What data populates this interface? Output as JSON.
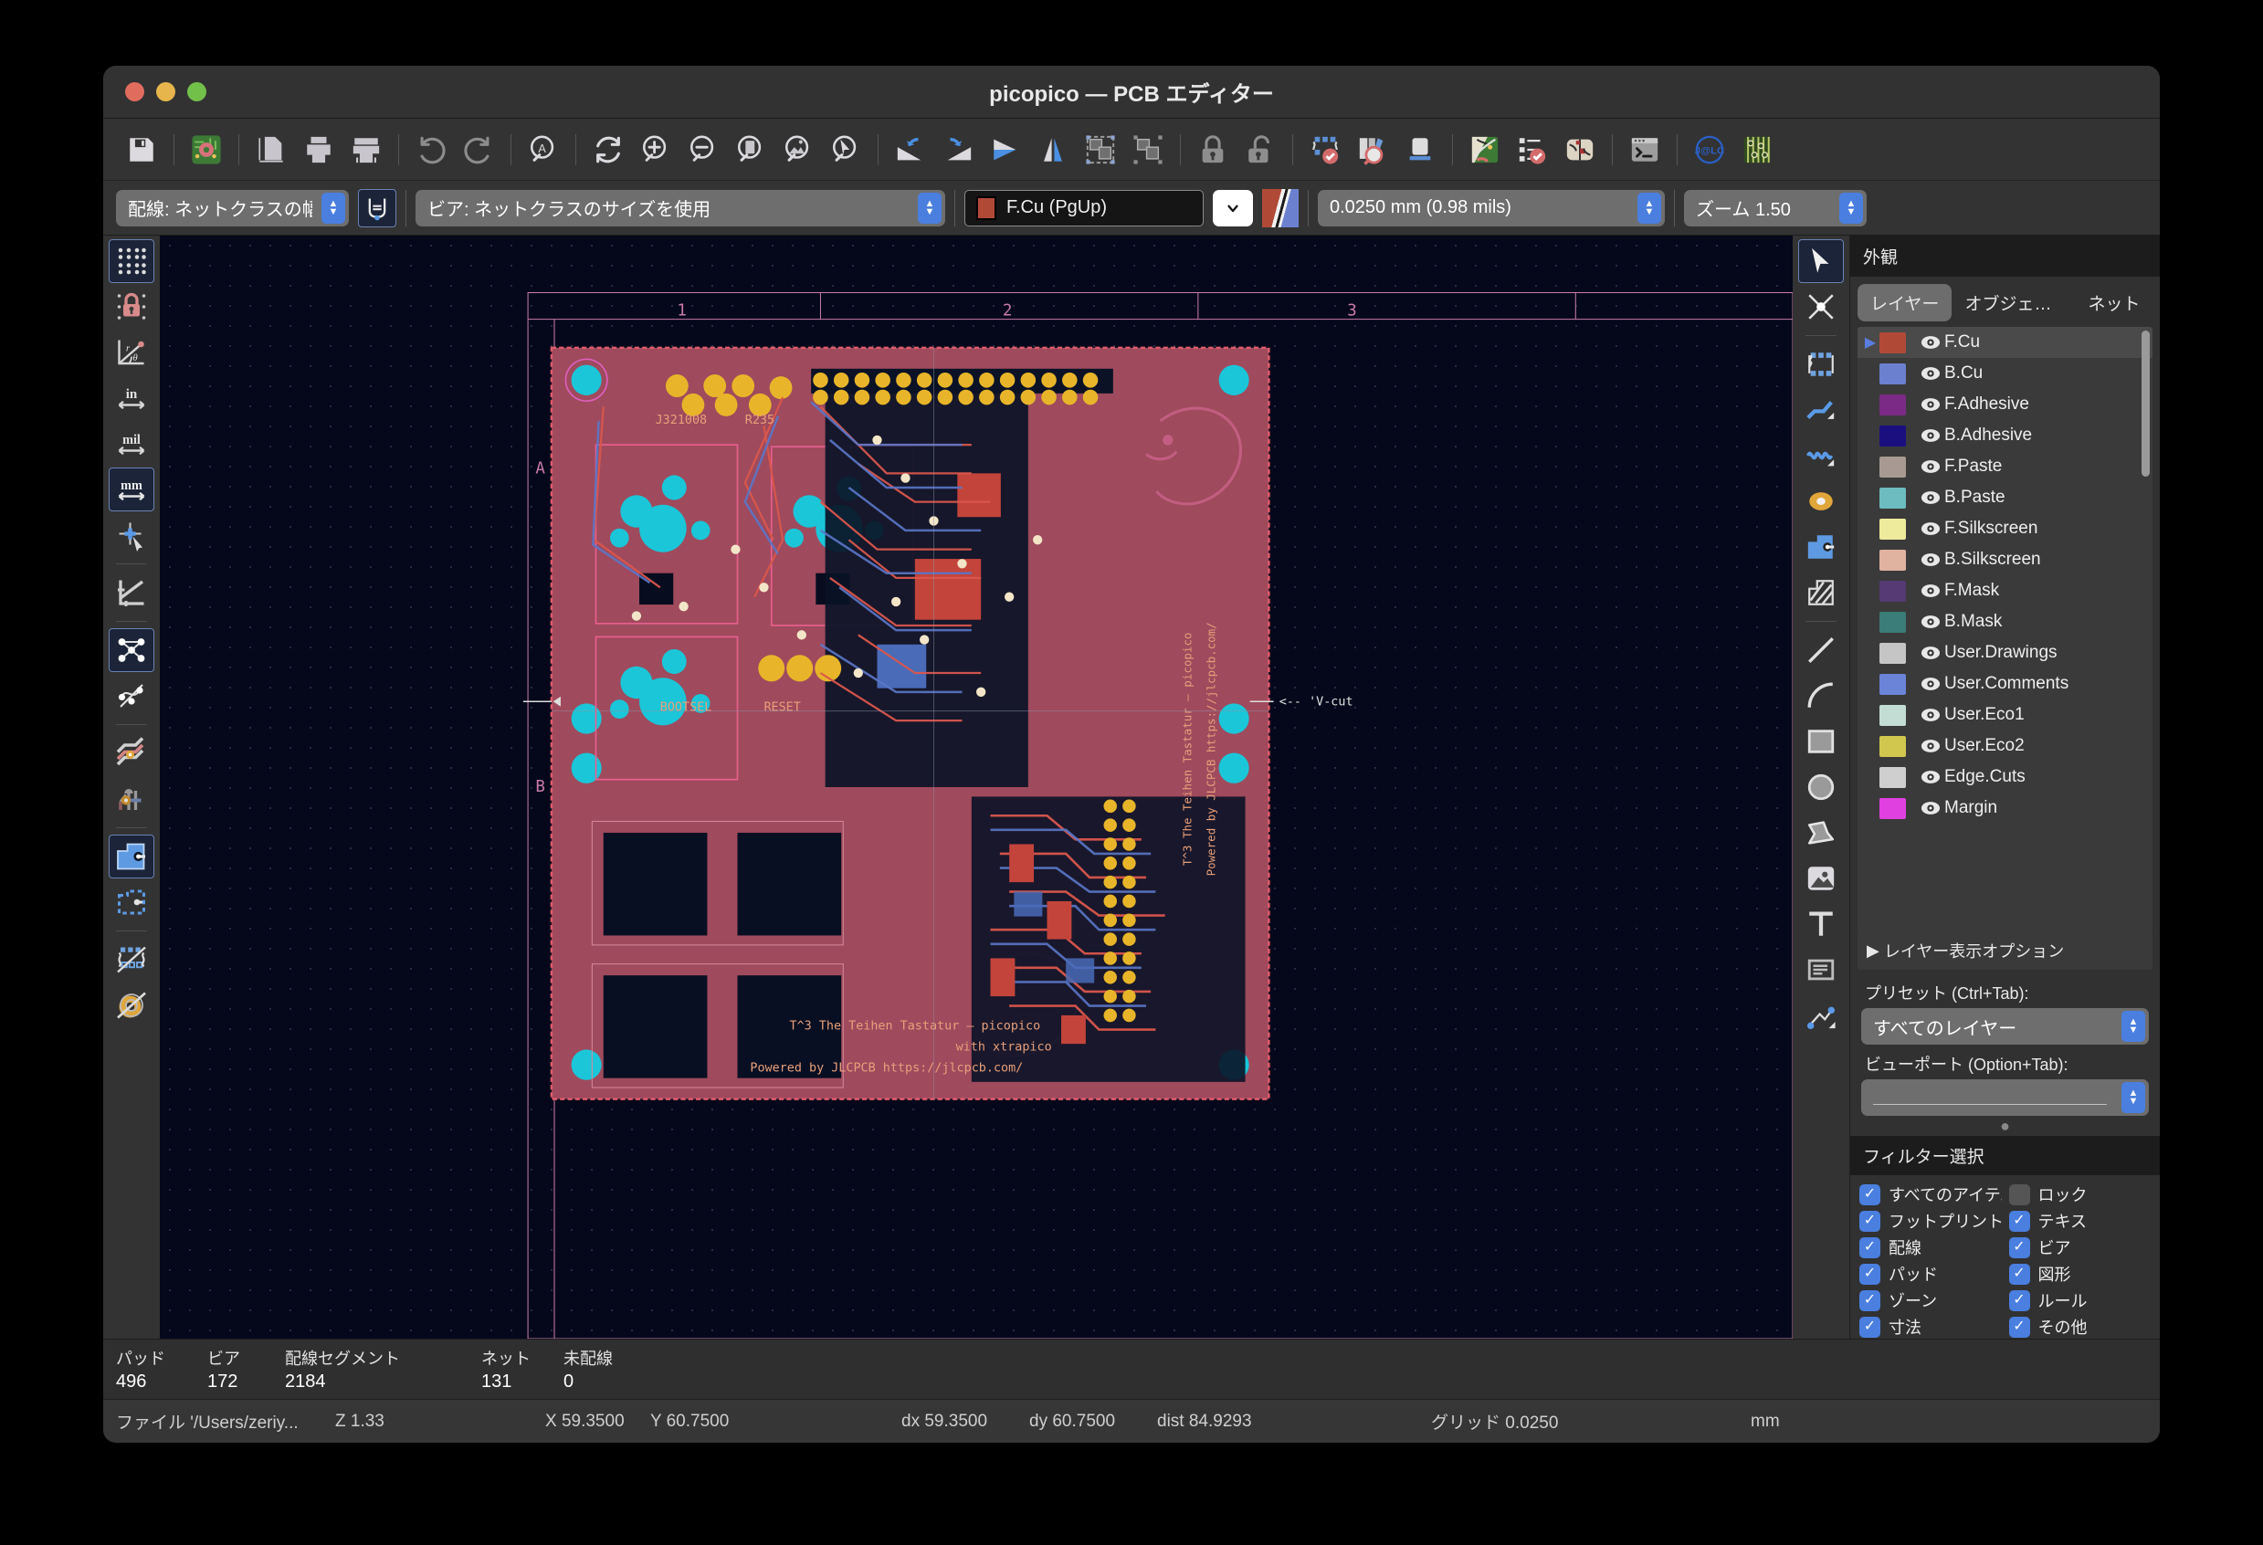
{
  "window": {
    "title": "picopico — PCB エディター",
    "traffic_lights": [
      "close",
      "minimize",
      "zoom"
    ]
  },
  "main_toolbar": [
    {
      "name": "save-button",
      "icon": "floppy-disk-icon"
    },
    {
      "name": "board-setup-button",
      "icon": "board-setup-icon"
    },
    {
      "name": "page-settings-button",
      "icon": "page-settings-icon"
    },
    {
      "name": "print-button",
      "icon": "printer-icon"
    },
    {
      "name": "plot-button",
      "icon": "plotter-icon"
    },
    {
      "name": "undo-button",
      "icon": "undo-arrow-icon"
    },
    {
      "name": "redo-button",
      "icon": "redo-arrow-icon"
    },
    {
      "name": "find-button",
      "icon": "find-text-icon"
    },
    {
      "name": "refresh-button",
      "icon": "refresh-icon"
    },
    {
      "name": "zoom-in-button",
      "icon": "zoom-in-icon"
    },
    {
      "name": "zoom-out-button",
      "icon": "zoom-out-icon"
    },
    {
      "name": "zoom-fit-page-button",
      "icon": "zoom-fit-page-icon"
    },
    {
      "name": "zoom-fit-objects-button",
      "icon": "zoom-fit-objects-icon"
    },
    {
      "name": "zoom-select-button",
      "icon": "zoom-selection-icon"
    },
    {
      "name": "rotate-ccw-button",
      "icon": "rotate-ccw-icon"
    },
    {
      "name": "rotate-cw-button",
      "icon": "rotate-cw-icon"
    },
    {
      "name": "flip-horizontal-button",
      "icon": "flip-horizontal-icon"
    },
    {
      "name": "mirror-button",
      "icon": "mirror-icon"
    },
    {
      "name": "group-button",
      "icon": "group-icon"
    },
    {
      "name": "ungroup-button",
      "icon": "ungroup-icon"
    },
    {
      "name": "lock-button",
      "icon": "lock-closed-icon"
    },
    {
      "name": "unlock-button",
      "icon": "lock-open-icon"
    },
    {
      "name": "footprint-editor-button",
      "icon": "footprint-editor-icon"
    },
    {
      "name": "footprint-browser-button",
      "icon": "footprint-browser-icon"
    },
    {
      "name": "viewer-3d-button",
      "icon": "three-d-viewer-icon"
    },
    {
      "name": "update-pcb-button",
      "icon": "update-pcb-from-schematic-icon"
    },
    {
      "name": "drc-button",
      "icon": "design-rules-check-icon"
    },
    {
      "name": "netlist-button",
      "icon": "net-inspector-icon"
    },
    {
      "name": "scripting-console-button",
      "icon": "python-console-icon"
    },
    {
      "name": "jlc-tools-button",
      "icon": "jlc-logo-icon"
    },
    {
      "name": "fabrication-toolkit-button",
      "icon": "fabrication-toolkit-icon"
    }
  ],
  "secondary_toolbar": {
    "track_width": {
      "label": "配線: ネットクラスの幅を使用",
      "name": "track-width-select"
    },
    "track_width_auto": {
      "name": "auto-track-width-toggle",
      "icon": "auto-track-width-icon",
      "active": true
    },
    "via_size": {
      "label": "ビア: ネットクラスのサイズを使用",
      "name": "via-size-select"
    },
    "active_layer": {
      "label": "F.Cu (PgUp)",
      "color": "#b04a37",
      "name": "active-layer-select"
    },
    "layer_dropdown": {
      "name": "layer-dropdown-button",
      "icon": "chevron-down-icon"
    },
    "layer_pair": {
      "name": "layer-pair-swatch",
      "front": "#b04a37",
      "back": "#6b81cf"
    },
    "grid_size": {
      "label": "0.0250 mm (0.98 mils)",
      "name": "grid-size-select"
    },
    "zoom_level": {
      "label": "ズーム 1.50",
      "name": "zoom-level-select"
    }
  },
  "left_toolbar": [
    {
      "name": "toggle-grid-button",
      "icon": "grid-dots-icon",
      "active": true
    },
    {
      "name": "grid-lock-button",
      "icon": "grid-lock-icon",
      "active": false
    },
    {
      "name": "polar-coords-button",
      "icon": "polar-coordinates-icon",
      "active": false
    },
    {
      "name": "units-inches-button",
      "icon": "unit-inch-icon",
      "active": false
    },
    {
      "name": "units-mils-button",
      "icon": "unit-mil-icon",
      "active": false
    },
    {
      "name": "units-mm-button",
      "icon": "unit-mm-icon",
      "active": true
    },
    {
      "name": "full-crosshair-button",
      "icon": "crosshair-cursor-icon",
      "active": false
    },
    {
      "name": "show-ratsnest-45-button",
      "icon": "angle-measure-icon",
      "active": false
    },
    {
      "name": "show-ratsnest-button",
      "icon": "ratsnest-icon",
      "active": true
    },
    {
      "name": "ratsnest-curved-button",
      "icon": "ratsnest-curved-icon",
      "active": false
    },
    {
      "name": "track-fill-button",
      "icon": "track-filled-icon",
      "active": false
    },
    {
      "name": "via-fill-button",
      "icon": "via-filled-icon",
      "active": false
    },
    {
      "name": "zone-filled-button",
      "icon": "zone-filled-icon",
      "active": true
    },
    {
      "name": "zone-outline-button",
      "icon": "zone-outline-icon",
      "active": false
    },
    {
      "name": "footprint-sketch-button",
      "icon": "footprint-sketch-icon",
      "active": false
    },
    {
      "name": "pad-sketch-button",
      "icon": "pad-sketch-icon",
      "active": false
    }
  ],
  "right_toolbar": [
    {
      "name": "select-tool-button",
      "icon": "cursor-arrow-icon",
      "active": true
    },
    {
      "name": "highlight-net-tool-button",
      "icon": "highlight-net-icon",
      "active": false
    },
    {
      "name": "place-footprint-tool-button",
      "icon": "place-footprint-icon",
      "active": false
    },
    {
      "name": "route-track-tool-button",
      "icon": "route-track-icon",
      "active": false
    },
    {
      "name": "route-diff-pair-tool-button",
      "icon": "route-differential-pair-icon",
      "active": false
    },
    {
      "name": "add-via-tool-button",
      "icon": "add-via-icon",
      "active": false
    },
    {
      "name": "add-zone-tool-button",
      "icon": "add-filled-zone-icon",
      "active": false
    },
    {
      "name": "add-rule-area-tool-button",
      "icon": "add-rule-area-icon",
      "active": false
    },
    {
      "name": "draw-line-tool-button",
      "icon": "draw-line-icon",
      "active": false
    },
    {
      "name": "draw-arc-tool-button",
      "icon": "draw-arc-icon",
      "active": false
    },
    {
      "name": "draw-rectangle-tool-button",
      "icon": "draw-rectangle-icon",
      "active": false
    },
    {
      "name": "draw-circle-tool-button",
      "icon": "draw-circle-icon",
      "active": false
    },
    {
      "name": "draw-polygon-tool-button",
      "icon": "draw-polygon-icon",
      "active": false
    },
    {
      "name": "place-image-tool-button",
      "icon": "place-image-icon",
      "active": false
    },
    {
      "name": "add-text-tool-button",
      "icon": "add-text-icon",
      "active": false
    },
    {
      "name": "add-textbox-tool-button",
      "icon": "add-textbox-icon",
      "active": false
    },
    {
      "name": "add-dimension-tool-button",
      "icon": "add-dimension-icon",
      "active": false
    }
  ],
  "appearance": {
    "title": "外観",
    "tabs": [
      {
        "label": "レイヤー",
        "name": "tab-layers",
        "active": true
      },
      {
        "label": "オブジェ…",
        "name": "tab-objects",
        "active": false
      },
      {
        "label": "ネット",
        "name": "tab-nets",
        "active": false
      }
    ],
    "layers": [
      {
        "name": "F.Cu",
        "color": "#b04a37",
        "visible": true,
        "selected": true
      },
      {
        "name": "B.Cu",
        "color": "#6b81cf",
        "visible": true,
        "selected": false
      },
      {
        "name": "F.Adhesive",
        "color": "#7b2b86",
        "visible": true,
        "selected": false
      },
      {
        "name": "B.Adhesive",
        "color": "#1b0f80",
        "visible": true,
        "selected": false
      },
      {
        "name": "F.Paste",
        "color": "#a89a92",
        "visible": true,
        "selected": false
      },
      {
        "name": "B.Paste",
        "color": "#6dbcbf",
        "visible": true,
        "selected": false
      },
      {
        "name": "F.Silkscreen",
        "color": "#eeeb9c",
        "visible": true,
        "selected": false
      },
      {
        "name": "B.Silkscreen",
        "color": "#e0b2a0",
        "visible": true,
        "selected": false
      },
      {
        "name": "F.Mask",
        "color": "#553a74",
        "visible": true,
        "selected": false
      },
      {
        "name": "B.Mask",
        "color": "#3b7d78",
        "visible": true,
        "selected": false
      },
      {
        "name": "User.Drawings",
        "color": "#c5c5c5",
        "visible": true,
        "selected": false
      },
      {
        "name": "User.Comments",
        "color": "#6b84d8",
        "visible": true,
        "selected": false
      },
      {
        "name": "User.Eco1",
        "color": "#c3ddd4",
        "visible": true,
        "selected": false
      },
      {
        "name": "User.Eco2",
        "color": "#d2c74e",
        "visible": true,
        "selected": false
      },
      {
        "name": "Edge.Cuts",
        "color": "#cfcfcf",
        "visible": true,
        "selected": false
      },
      {
        "name": "Margin",
        "color": "#e040e0",
        "visible": true,
        "selected": false
      }
    ],
    "layer_display_options": "レイヤー表示オプション",
    "preset_label": "プリセット (Ctrl+Tab):",
    "preset_value": "すべてのレイヤー",
    "viewport_label": "ビューポート (Option+Tab):",
    "viewport_value": ""
  },
  "filter_panel": {
    "title": "フィルター選択",
    "left_column": [
      {
        "label": "すべてのアイテム",
        "checked": true,
        "name": "filter-all-items"
      },
      {
        "label": "フットプリント",
        "checked": true,
        "name": "filter-footprints"
      },
      {
        "label": "配線",
        "checked": true,
        "name": "filter-tracks"
      },
      {
        "label": "パッド",
        "checked": true,
        "name": "filter-pads"
      },
      {
        "label": "ゾーン",
        "checked": true,
        "name": "filter-zones"
      },
      {
        "label": "寸法",
        "checked": true,
        "name": "filter-dimensions"
      }
    ],
    "right_column": [
      {
        "label": "ロック",
        "checked": false,
        "name": "filter-locked-items"
      },
      {
        "label": "テキス",
        "checked": true,
        "name": "filter-text"
      },
      {
        "label": "ビア",
        "checked": true,
        "name": "filter-vias"
      },
      {
        "label": "図形",
        "checked": true,
        "name": "filter-graphics"
      },
      {
        "label": "ルール",
        "checked": true,
        "name": "filter-rule-areas"
      },
      {
        "label": "その他",
        "checked": true,
        "name": "filter-other-items"
      }
    ]
  },
  "stats": [
    {
      "label": "パッド",
      "value": "496",
      "name": "stat-pads"
    },
    {
      "label": "ビア",
      "value": "172",
      "name": "stat-vias"
    },
    {
      "label": "配線セグメント",
      "value": "2184",
      "name": "stat-track-segments"
    },
    {
      "label": "ネット",
      "value": "131",
      "name": "stat-nets"
    },
    {
      "label": "未配線",
      "value": "0",
      "name": "stat-unrouted"
    }
  ],
  "statusbar": {
    "file": "ファイル '/Users/zeriy...",
    "zoom": "Z 1.33",
    "x": "X 59.3500",
    "y": "Y 60.7500",
    "dx": "dx 59.3500",
    "dy": "dy 60.7500",
    "dist": "dist 84.9293",
    "grid": "グリッド 0.0250",
    "units": "mm"
  },
  "canvas": {
    "ruler_marks": [
      "1",
      "2",
      "3"
    ],
    "side_marks": [
      "A",
      "B"
    ],
    "silkscreen": [
      {
        "text": "J321008",
        "name": "silk-ref-j321008"
      },
      {
        "text": "R235",
        "name": "silk-ref-r235"
      },
      {
        "text": "BOOTSEL",
        "name": "silk-label-bootsel"
      },
      {
        "text": "RESET",
        "name": "silk-label-reset"
      },
      {
        "text": "<-- 'V-cut",
        "name": "annotation-vcut"
      },
      {
        "text": "T^3 The Teihen Tastatur — picopico",
        "name": "silk-board-title"
      },
      {
        "text": "with xtrapico",
        "name": "silk-board-subtitle"
      },
      {
        "text": "Powered by JLCPCB https://jlcpcb.com/",
        "name": "silk-board-credit"
      },
      {
        "text": "T^3 The Teihen Tastatur — picopico",
        "name": "silk-side-title"
      },
      {
        "text": "Powered by JLCPCB  https://jlcpcb.com/",
        "name": "silk-side-credit"
      }
    ],
    "board_color": "#a04a5e",
    "background_color": "#04081a"
  }
}
